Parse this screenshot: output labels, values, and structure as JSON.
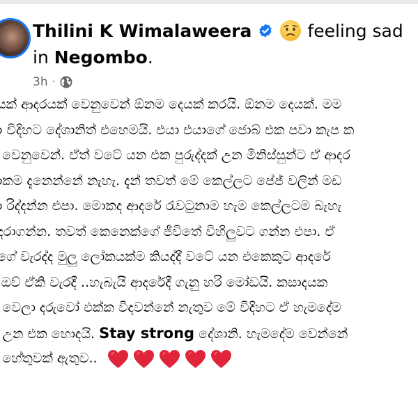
{
  "post": {
    "author_name": "Thilini K Wimalaweera",
    "feeling_text": "feeling sad",
    "location_prefix": "in",
    "location": "Negombo",
    "location_suffix": ".",
    "time": "3h",
    "separator": "·",
    "icons": {
      "verified": "verified-badge-icon",
      "feeling": "sad-face-emoji-icon",
      "privacy": "globe-icon",
      "heart": "red-heart-emoji-icon"
    },
    "colors": {
      "verified": "#1877f2",
      "meta_text": "#65676b",
      "heart": "#e0243a"
    },
    "body_lines": [
      "යෙක් ආදරයක් වෙනුවෙන් ඕනම දෙයක් කරයි. ඕනම දෙයක්. මම",
      "ා විදිහට දේශානිත් එහෙමයි. එයා එයාගේ ජොබ් එක පවා කැප ක",
      "ී වෙනුවෙන්. ඒත් වටේ යන එක පුරුද්දක් උන මිනිස්සුන්ට ඒ ආදර",
      "ාකම දැනෙන්නේ නැහැ. දැන් තවත් මේ කෙල්ලට පේජ් වලින් මඩ",
      "ා රිද්දන්න එපා. මොකද ආදරේ රැවටුනාම හැම කෙල්ලටම බැහැ",
      "ද් දරාගන්න. තවත් කෙනෙක්ගේ ජීවිතේ විහිලුවට ගන්න එපා. ඒ",
      "ලගේ වැරද්ද මුලු ලෝකයක්ම කියද්දී වටේ යන එකෙකුට ආදරේ",
      "ම ඔව් ඒකි වැරදී ..හැබැයි ආදරේදී ගැනු හරි මෝඩයි. කසාදයක",
      "න් වෙලා දරුවෝ එක්ක විදවන්නේ නැතුව මේ විදිහට ඒ හැමදේම",
      "න්  උන එක හොදයි.",
      "න් හේතුවක් ඇතුව.."
    ],
    "strong_text": "Stay strong",
    "line10_tail": "දේශානි. හැමදේම වෙන්නේ"
  }
}
